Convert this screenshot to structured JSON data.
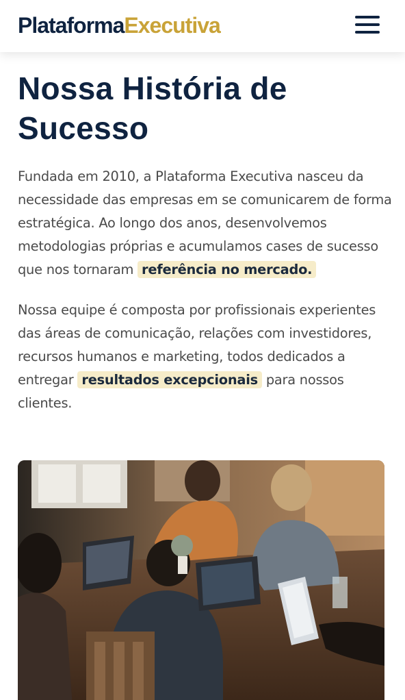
{
  "header": {
    "logo_part1": "Plataforma",
    "logo_part2": "Executiva",
    "menu_icon": "hamburger-icon"
  },
  "main": {
    "title": "Nossa História de Sucesso",
    "paragraph1": {
      "text": "Fundada em 2010, a Plataforma Executiva nasceu da necessidade das empresas em se comunicarem de forma estratégica. Ao longo dos anos, desenvolvemos metodologias próprias e acumulamos cases de sucesso que nos tornaram",
      "highlight": "referência no mercado."
    },
    "paragraph2": {
      "text": "Nossa equipe é composta por profissionais experientes das áreas de comunicação, relações com investidores, recursos humanos e marketing, todos dedicados a entregar",
      "highlight": "resultados excepcionais",
      "text_after": "para nossos clientes."
    }
  },
  "colors": {
    "navy": "#0f2340",
    "gold": "#c9a338",
    "highlight_bg": "#f6ecc9",
    "body_text": "#4a4a4a"
  }
}
